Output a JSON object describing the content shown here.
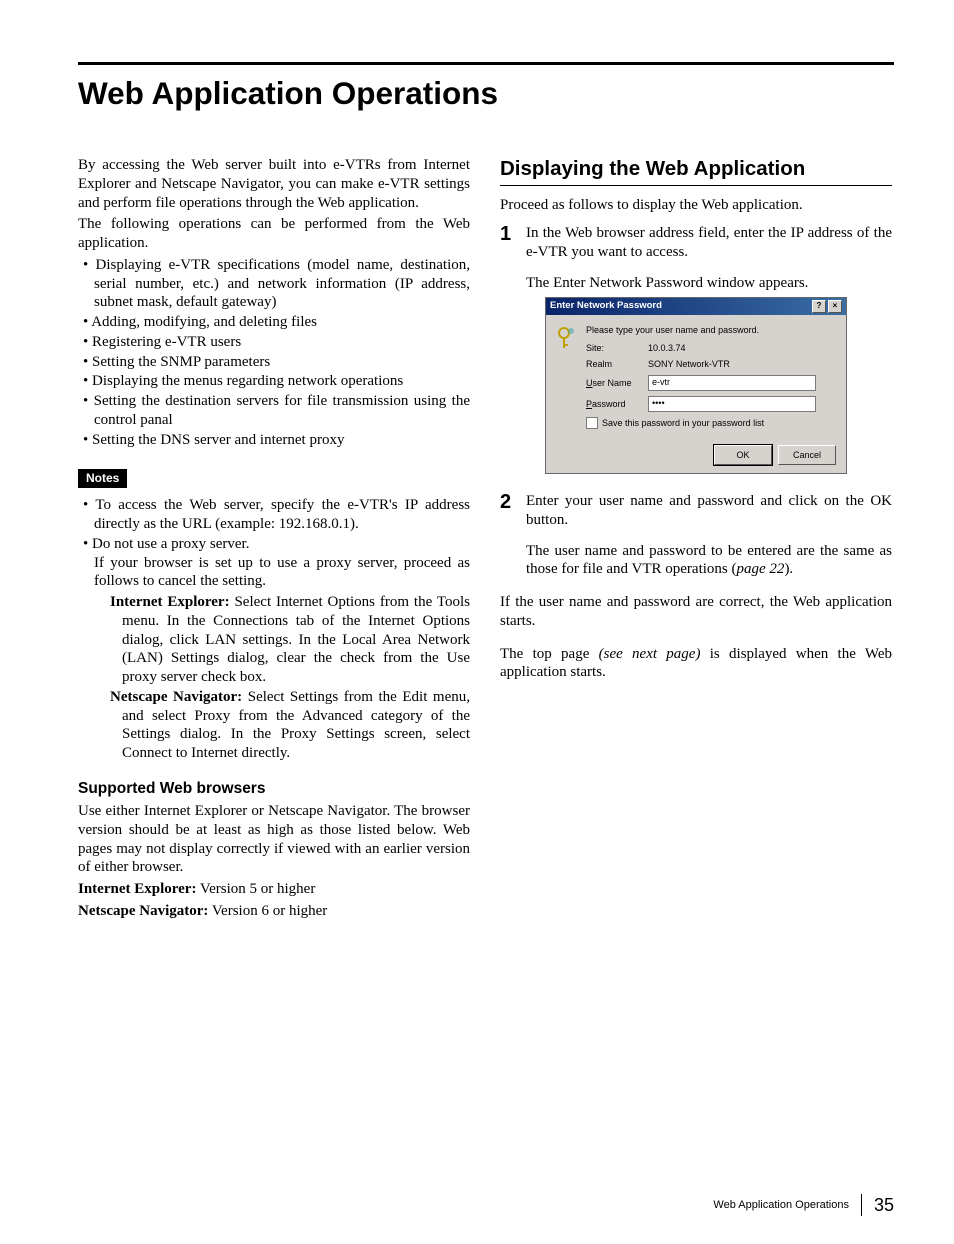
{
  "title": "Web Application Operations",
  "left": {
    "intro1": "By accessing the Web server built into e-VTRs from Internet Explorer and Netscape Navigator, you can make e-VTR settings and perform file operations through the Web application.",
    "intro2": "The following operations can be performed from the Web application.",
    "ops": [
      "Displaying e-VTR specifications (model name, destination, serial number, etc.) and network information (IP address, subnet mask, default gateway)",
      "Adding, modifying, and deleting files",
      "Registering e-VTR users",
      "Setting the SNMP parameters",
      "Displaying the menus regarding network operations",
      "Setting the destination servers for file transmission using the control panal",
      "Setting the DNS server and internet proxy"
    ],
    "notes_label": "Notes",
    "note1": "To access the Web server, specify the e-VTR's IP address directly as the URL (example: 192.168.0.1).",
    "note2": "Do not use a proxy server.",
    "note2b": "If your browser is set up to use a proxy server, proceed as follows to cancel the setting.",
    "ie_label": "Internet Explorer:",
    "ie_text": " Select Internet Options from the Tools menu. In the Connections tab of the Internet Options dialog, click LAN settings. In the Local Area Network (LAN) Settings dialog, clear the check from the Use proxy server check box.",
    "nn_label": "Netscape Navigator:",
    "nn_text": " Select Settings from the Edit menu, and select Proxy from the Advanced category of the Settings dialog. In the Proxy Settings screen, select Connect to Internet directly.",
    "browsers_heading": "Supported Web browsers",
    "browsers_para": "Use either Internet Explorer or Netscape Navigator. The browser version should be at least as high as those listed below. Web pages may not display correctly if viewed with an earlier version of either browser.",
    "ie_ver_label": "Internet Explorer:",
    "ie_ver_text": " Version 5 or higher",
    "nn_ver_label": "Netscape Navigator:",
    "nn_ver_text": " Version 6 or higher"
  },
  "right": {
    "heading": "Displaying the Web Application",
    "intro": "Proceed as follows to display the Web application.",
    "step1a": "In the Web browser address field, enter the IP address of the e-VTR you want to access.",
    "step1b": "The Enter Network Password window appears.",
    "step2a": "Enter your user name and password and click on the OK button.",
    "step2b_pre": "The user name and password to be entered are the same as those for file and VTR operations (",
    "step2b_ref": "page 22",
    "step2b_post": ").",
    "after1": "If the user name and password are correct, the Web application starts.",
    "after2_pre": "The top page ",
    "after2_ref": "(see next page)",
    "after2_post": " is displayed when the Web application starts."
  },
  "dialog": {
    "title": "Enter Network Password",
    "prompt": "Please type your user name and password.",
    "site_label": "Site:",
    "site_value": "10.0.3.74",
    "realm_label": "Realm",
    "realm_value": "SONY Network-VTR",
    "user_label_pre": "U",
    "user_label_post": "ser Name",
    "user_value": "e-vtr",
    "pass_label_pre": "P",
    "pass_label_post": "assword",
    "pass_value": "••••",
    "save_pre": "S",
    "save_post": "ave this password in your password list",
    "ok": "OK",
    "cancel": "Cancel"
  },
  "footer": {
    "caption": "Web Application Operations",
    "page": "35"
  }
}
